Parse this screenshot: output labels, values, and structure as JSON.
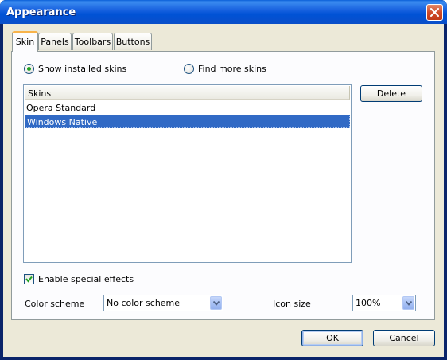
{
  "window": {
    "title": "Appearance"
  },
  "tabs": [
    {
      "label": "Skin",
      "active": true
    },
    {
      "label": "Panels",
      "active": false
    },
    {
      "label": "Toolbars",
      "active": false
    },
    {
      "label": "Buttons",
      "active": false
    }
  ],
  "skin": {
    "radio_installed": {
      "label": "Show installed skins",
      "checked": true
    },
    "radio_find": {
      "label": "Find more skins",
      "checked": false
    },
    "list": {
      "header": "Skins",
      "items": [
        "Opera Standard",
        "Windows Native"
      ],
      "selected": "Windows Native"
    },
    "delete_label": "Delete",
    "effects": {
      "label": "Enable special effects",
      "checked": true
    },
    "color_scheme": {
      "label": "Color scheme",
      "value": "No color scheme"
    },
    "icon_size": {
      "label": "Icon size",
      "value": "100%"
    }
  },
  "footer": {
    "ok_label": "OK",
    "cancel_label": "Cancel"
  },
  "icons": {
    "close": "close-icon",
    "check": "checkmark-icon",
    "dropdown": "chevron-down-icon"
  },
  "colors": {
    "titlebar": "#0052d6",
    "selection": "#316ac5",
    "dialog_bg": "#ece9d8",
    "active_tab_accent": "#f8b34a",
    "close_button": "#cf4b2a"
  }
}
